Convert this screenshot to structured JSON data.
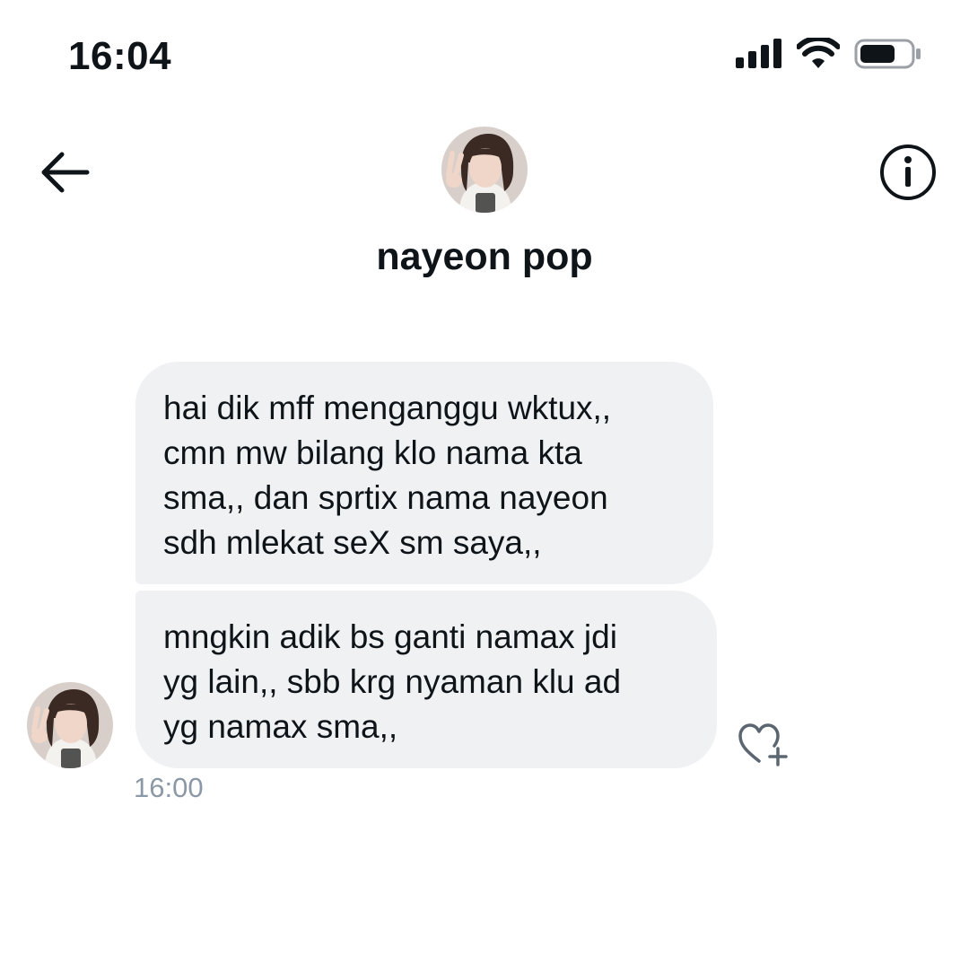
{
  "status_bar": {
    "time": "16:04",
    "icons": [
      "signal-icon",
      "wifi-icon",
      "battery-icon"
    ],
    "battery_level": 0.7
  },
  "header": {
    "contact_name": "nayeon pop",
    "back_icon": "back-arrow-icon",
    "info_icon": "info-icon"
  },
  "messages": [
    {
      "lines": [
        "hai dik mff menganggu wktux,,",
        "cmn mw bilang klo nama kta",
        "sma,, dan sprtix nama nayeon",
        "sdh mlekat seX sm saya,,"
      ]
    },
    {
      "lines": [
        "mngkin adik bs ganti namax jdi",
        "yg lain,, sbb krg nyaman klu ad",
        "yg namax sma,,"
      ]
    }
  ],
  "message_time": "16:00",
  "react_icon": "heart-plus-icon",
  "colors": {
    "bubble_bg": "#eff1f3",
    "text": "#0f1419",
    "timestamp": "#8b98a5"
  }
}
